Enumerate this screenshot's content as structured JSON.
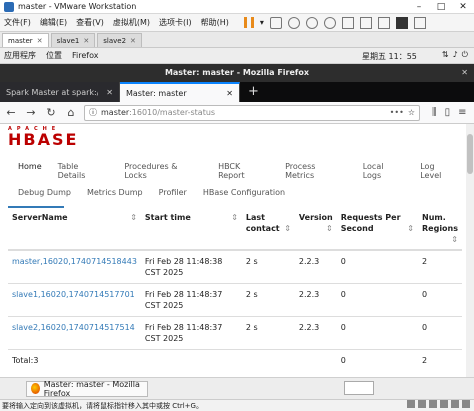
{
  "vmware": {
    "title": "master - VMware Workstation",
    "menu": [
      "文件(F)",
      "编辑(E)",
      "查看(V)",
      "虚拟机(M)",
      "选项卡(I)",
      "帮助(H)"
    ],
    "tabs": [
      {
        "label": "master",
        "active": true
      },
      {
        "label": "slave1",
        "active": false
      },
      {
        "label": "slave2",
        "active": false
      }
    ],
    "status_text": "要将输入定向到该虚拟机，请将鼠标指针移入其中或按 Ctrl+G。"
  },
  "gnome": {
    "apps": "应用程序",
    "places": "位置",
    "firefox": "Firefox",
    "clock": "星期五 11：55"
  },
  "firefox": {
    "window_title": "Master: master - Mozilla Firefox",
    "tabs": [
      {
        "label": "Spark Master at spark://m",
        "active": false
      },
      {
        "label": "Master: master",
        "active": true
      }
    ],
    "url_host": "master",
    "url_path": ":16010/master-status"
  },
  "page": {
    "logo_top": "APACHE",
    "logo_main": "HBASE",
    "nav": [
      "Home",
      "Table Details",
      "Procedures & Locks",
      "HBCK Report",
      "Process Metrics",
      "Local Logs",
      "Log Level"
    ],
    "subnav": [
      "Debug Dump",
      "Metrics Dump",
      "Profiler",
      "HBase Configuration"
    ],
    "table": {
      "headers": [
        "ServerName",
        "Start time",
        "Last contact",
        "Version",
        "Requests Per Second",
        "Num. Regions"
      ],
      "rows": [
        {
          "server": "master,16020,1740714518443",
          "start": "Fri Feb 28 11:48:38 CST 2025",
          "contact": "2 s",
          "version": "2.2.3",
          "rps": "0",
          "regions": "2"
        },
        {
          "server": "slave1,16020,1740714517701",
          "start": "Fri Feb 28 11:48:37 CST 2025",
          "contact": "2 s",
          "version": "2.2.3",
          "rps": "0",
          "regions": "0"
        },
        {
          "server": "slave2,16020,1740714517514",
          "start": "Fri Feb 28 11:48:37 CST 2025",
          "contact": "2 s",
          "version": "2.2.3",
          "rps": "0",
          "regions": "0"
        }
      ],
      "total_label": "Total:3",
      "total_rps": "0",
      "total_regions": "2"
    }
  },
  "taskbar": {
    "task_label": "Master: master - Mozilla Firefox"
  }
}
